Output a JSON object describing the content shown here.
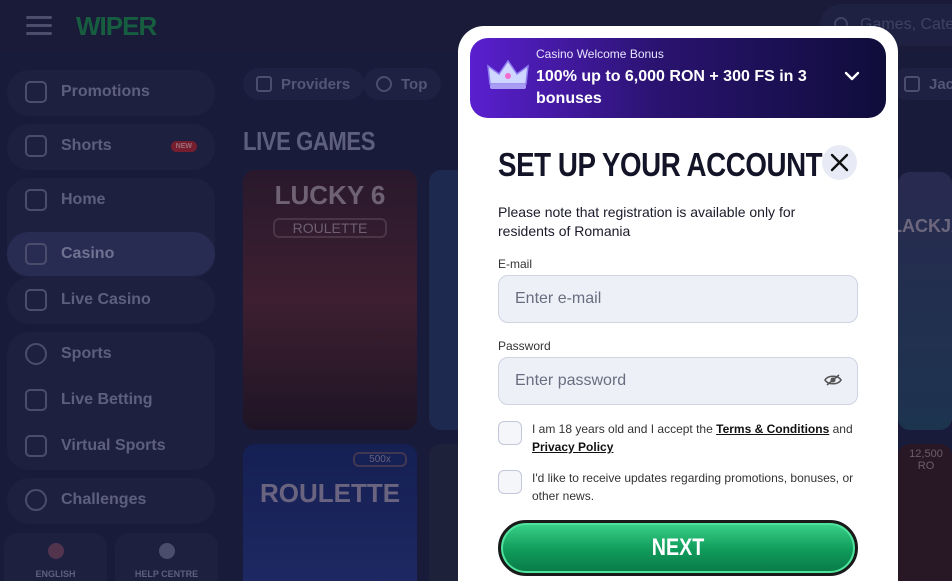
{
  "header": {
    "logo": "WIPER",
    "search_placeholder": "Games, Cate"
  },
  "sidebar": {
    "items": [
      {
        "label": "Promotions"
      },
      {
        "label": "Shorts",
        "badge": "NEW"
      },
      {
        "label": "Home"
      },
      {
        "label": "Casino"
      },
      {
        "label": "Live Casino"
      },
      {
        "label": "Sports"
      },
      {
        "label": "Live Betting"
      },
      {
        "label": "Virtual Sports"
      },
      {
        "label": "Challenges"
      }
    ],
    "bottom": [
      {
        "label": "ENGLISH"
      },
      {
        "label": "HELP CENTRE"
      }
    ]
  },
  "filters": {
    "chips": [
      {
        "label": "Providers"
      },
      {
        "label": "Top"
      },
      {
        "label": "Jac"
      }
    ]
  },
  "main": {
    "section_title": "LIVE GAMES",
    "tiles": [
      {
        "name": "LUCKY 6",
        "sub": "ROULETTE"
      },
      {
        "name": "ROULETTE",
        "sub": "500x"
      },
      {
        "name": "BLACKJACK",
        "sub": "12,500 RO"
      }
    ]
  },
  "modal": {
    "bonus": {
      "subtitle": "Casino Welcome Bonus",
      "title": "100% up to 6,000 RON + 300 FS in 3 bonuses"
    },
    "title": "SET UP YOUR ACCOUNT",
    "note": "Please note that registration is available only for residents of Romania",
    "email_label": "E-mail",
    "email_placeholder": "Enter e-mail",
    "password_label": "Password",
    "password_placeholder": "Enter password",
    "age_text_pre": "I am 18 years old and I accept the",
    "terms_link": "Terms & Conditions",
    "and_text": "and",
    "privacy_link": "Privacy Policy",
    "updates_text": "I'd like to receive updates regarding promotions, bonuses, or other news.",
    "next_label": "NEXT"
  },
  "colors": {
    "accent_green": "#0f9a5a",
    "bonus_purple": "#5a1fd0",
    "backdrop": "#22244a"
  }
}
